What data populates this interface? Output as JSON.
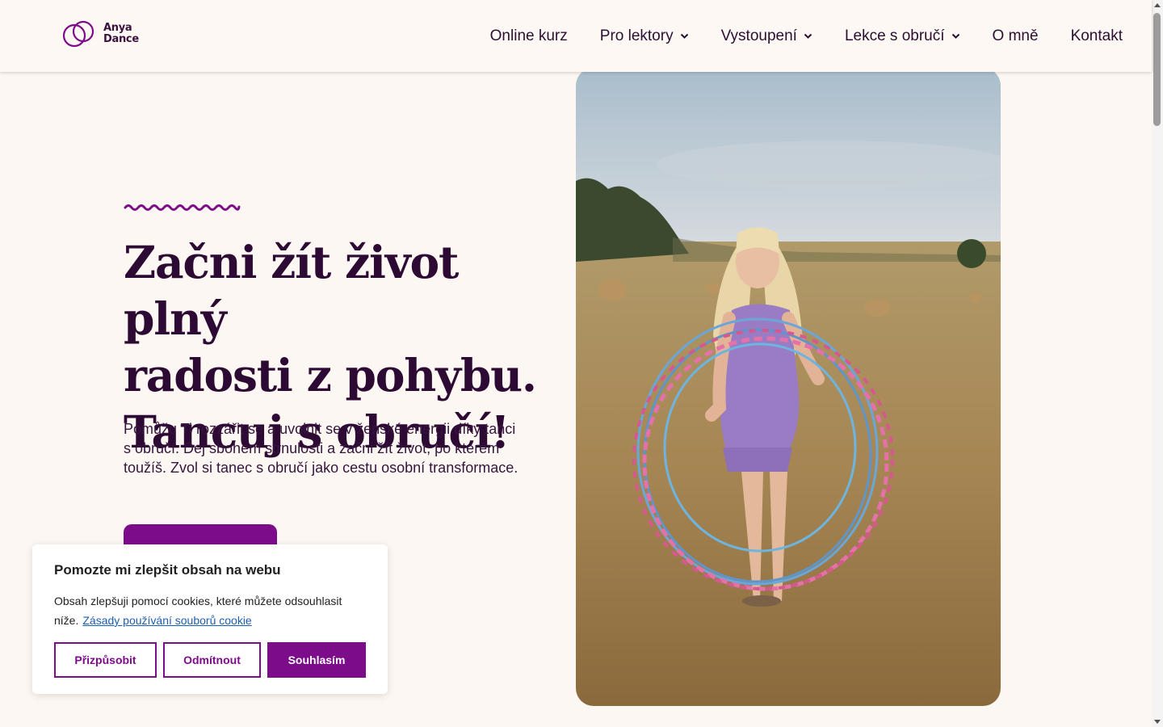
{
  "site": {
    "logo_line1": "Anya",
    "logo_line2": "Dance",
    "logo_icon": "two-interlocking-rings-logo",
    "accent_color": "#7d0c8a",
    "background_color": "#fdf7f3"
  },
  "nav": {
    "items": [
      {
        "label": "Online kurz",
        "has_dropdown": false
      },
      {
        "label": "Pro lektory",
        "has_dropdown": true
      },
      {
        "label": "Vystoupení",
        "has_dropdown": true
      },
      {
        "label": "Lekce s obručí",
        "has_dropdown": true
      },
      {
        "label": "O mně",
        "has_dropdown": false
      },
      {
        "label": "Kontakt",
        "has_dropdown": false
      }
    ],
    "dropdown_icon": "chevron-down-icon"
  },
  "hero": {
    "title_line1": "Začni žít život plný",
    "title_line2": "radosti z pohybu.",
    "title_line3": "Tancuj s obručí!",
    "text": "Pomůžu Ti rozzářit se a uvolnit se v ženské energii díky tanci s obručí. Dej sbohem strnulosti a začni žít život, po kterém toužíš. Zvol si tanec s obručí jako cestu osobní transformace.",
    "image_description_icon": "woman-with-hula-hoops-photo"
  },
  "cookie": {
    "title": "Pomozte mi zlepšit obsah na webu",
    "text": "Obsah zlepšuji pomocí cookies, které můžete odsouhlasit níže.",
    "link": "Zásady používání souborů cookie",
    "customize_label": "Přizpůsobit",
    "reject_label": "Odmítnout",
    "accept_label": "Souhlasím"
  }
}
